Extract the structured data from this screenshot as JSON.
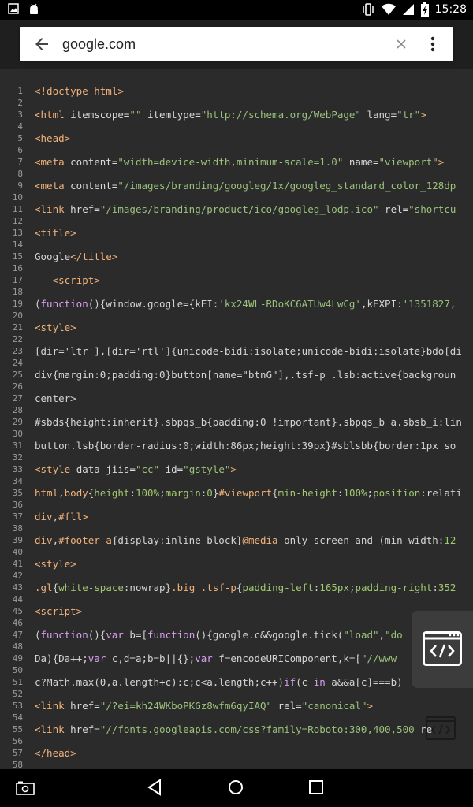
{
  "status_bar": {
    "time": "15:28",
    "icons_left": [
      "image-icon",
      "android-icon"
    ],
    "icons_right": [
      "vibrate-icon",
      "wifi-icon",
      "signal-icon",
      "battery-charging-icon"
    ]
  },
  "app_bar": {
    "url": "google.com",
    "back_icon": "arrow-back-icon",
    "clear_icon": "close-icon",
    "menu_icon": "more-vert-icon"
  },
  "code": {
    "line_numbers": [
      "1",
      "2",
      "3",
      "4",
      "5",
      "6",
      "7",
      "8",
      "9",
      "10",
      "11",
      "12",
      "13",
      "14",
      "15",
      "16",
      "17",
      "18",
      "19",
      "20",
      "21",
      "22",
      "23",
      "24",
      "25",
      "26",
      "27",
      "28",
      "29",
      "30",
      "31",
      "32",
      "33",
      "34",
      "35",
      "36",
      "37",
      "38",
      "39",
      "40",
      "41",
      "42",
      "43",
      "44",
      "45",
      "46",
      "47",
      "48",
      "49",
      "50",
      "51",
      "52",
      "53",
      "54",
      "55",
      "56",
      "57",
      "58"
    ],
    "lines": [
      {
        "n": 1,
        "segs": [
          [
            "tag",
            "<!doctype html>"
          ]
        ]
      },
      {
        "n": 3,
        "segs": [
          [
            "tag",
            "<html "
          ],
          [
            "attr",
            "itemscope="
          ],
          [
            "str",
            "\"\""
          ],
          [
            "attr",
            " itemtype="
          ],
          [
            "str",
            "\"http://schema.org/WebPage\""
          ],
          [
            "attr",
            " lang="
          ],
          [
            "str",
            "\"tr\""
          ],
          [
            "tag",
            ">"
          ]
        ]
      },
      {
        "n": 5,
        "segs": [
          [
            "tag",
            "<head>"
          ]
        ]
      },
      {
        "n": 7,
        "segs": [
          [
            "tag",
            "<meta "
          ],
          [
            "attr",
            "content="
          ],
          [
            "str",
            "\"width=device-width,minimum-scale=1.0\""
          ],
          [
            "attr",
            " name="
          ],
          [
            "str",
            "\"viewport\""
          ],
          [
            "tag",
            ">"
          ]
        ]
      },
      {
        "n": 9,
        "segs": [
          [
            "tag",
            "<meta "
          ],
          [
            "attr",
            "content="
          ],
          [
            "str",
            "\"/images/branding/googleg/1x/googleg_standard_color_128dp"
          ]
        ]
      },
      {
        "n": 11,
        "segs": [
          [
            "tag",
            "<link "
          ],
          [
            "attr",
            "href="
          ],
          [
            "str",
            "\"/images/branding/product/ico/googleg_lodp.ico\""
          ],
          [
            "attr",
            " rel="
          ],
          [
            "str",
            "\"shortcu"
          ]
        ]
      },
      {
        "n": 13,
        "segs": [
          [
            "tag",
            "<title>"
          ]
        ]
      },
      {
        "n": 15,
        "segs": [
          [
            "txt",
            "Google"
          ],
          [
            "tag",
            "</title>"
          ]
        ]
      },
      {
        "n": 17,
        "segs": [
          [
            "txt",
            "   "
          ],
          [
            "tag",
            "<script>"
          ]
        ]
      },
      {
        "n": 19,
        "segs": [
          [
            "txt",
            "("
          ],
          [
            "kw",
            "function"
          ],
          [
            "txt",
            "(){window.google={kEI:"
          ],
          [
            "str",
            "'kx24WL-RDoKC6ATUw4LwCg'"
          ],
          [
            "txt",
            ",kEXPI:"
          ],
          [
            "str",
            "'1351827,"
          ]
        ]
      },
      {
        "n": 21,
        "segs": [
          [
            "tag",
            "<style>"
          ]
        ]
      },
      {
        "n": 23,
        "segs": [
          [
            "txt",
            "[dir='ltr'],[dir='rtl']{unicode-bidi:isolate;unicode-bidi:isolate}bdo[di"
          ]
        ]
      },
      {
        "n": 25,
        "segs": [
          [
            "txt",
            "div{margin:0;padding:0}button[name=\"btnG\"],.tsf-p .lsb:active{backgroun"
          ]
        ]
      },
      {
        "n": 27,
        "segs": [
          [
            "txt",
            "center>"
          ]
        ]
      },
      {
        "n": 29,
        "segs": [
          [
            "txt",
            "#sbds{height:inherit}.sbpqs_b{padding:0 !important}.sbpqs_b a.sbsb_i:lin"
          ]
        ]
      },
      {
        "n": 31,
        "segs": [
          [
            "txt",
            "button.lsb{border-radius:0;width:86px;height:39px}#sblsbb{border:1px so"
          ]
        ]
      },
      {
        "n": 33,
        "segs": [
          [
            "tag",
            "<style "
          ],
          [
            "attr",
            "data-jiis="
          ],
          [
            "str",
            "\"cc\""
          ],
          [
            "attr",
            " id="
          ],
          [
            "str",
            "\"gstyle\""
          ],
          [
            "tag",
            ">"
          ]
        ]
      },
      {
        "n": 35,
        "segs": [
          [
            "tag",
            "html"
          ],
          [
            "txt",
            ","
          ],
          [
            "tag",
            "body"
          ],
          [
            "txt",
            "{"
          ],
          [
            "prop",
            "height"
          ],
          [
            "txt",
            ":"
          ],
          [
            "prop",
            "100%"
          ],
          [
            "txt",
            ";"
          ],
          [
            "prop",
            "margin"
          ],
          [
            "txt",
            ":"
          ],
          [
            "prop",
            "0"
          ],
          [
            "txt",
            "}"
          ],
          [
            "tag",
            "#viewport"
          ],
          [
            "txt",
            "{"
          ],
          [
            "prop",
            "min-height"
          ],
          [
            "txt",
            ":"
          ],
          [
            "prop",
            "100%"
          ],
          [
            "txt",
            ";"
          ],
          [
            "prop",
            "position"
          ],
          [
            "txt",
            ":relati"
          ]
        ]
      },
      {
        "n": 37,
        "segs": [
          [
            "tag",
            "div"
          ],
          [
            "txt",
            ","
          ],
          [
            "tag",
            "#fll"
          ],
          [
            "tag",
            ">"
          ]
        ]
      },
      {
        "n": 39,
        "segs": [
          [
            "tag",
            "div"
          ],
          [
            "txt",
            ","
          ],
          [
            "tag",
            "#footer a"
          ],
          [
            "txt",
            "{display:inline-block}"
          ],
          [
            "tag",
            "@media"
          ],
          [
            "txt",
            " only screen and (min-width:"
          ],
          [
            "prop",
            "12"
          ]
        ]
      },
      {
        "n": 41,
        "segs": [
          [
            "tag",
            "<style>"
          ]
        ]
      },
      {
        "n": 43,
        "segs": [
          [
            "tag",
            ".gl"
          ],
          [
            "txt",
            "{"
          ],
          [
            "prop",
            "white-space"
          ],
          [
            "txt",
            ":nowrap}"
          ],
          [
            "tag",
            ".big .tsf-p"
          ],
          [
            "txt",
            "{"
          ],
          [
            "prop",
            "padding-left"
          ],
          [
            "txt",
            ":"
          ],
          [
            "prop",
            "165px"
          ],
          [
            "txt",
            ";"
          ],
          [
            "prop",
            "padding-right"
          ],
          [
            "txt",
            ":"
          ],
          [
            "prop",
            "352"
          ]
        ]
      },
      {
        "n": 45,
        "segs": [
          [
            "tag",
            "<script>"
          ]
        ]
      },
      {
        "n": 47,
        "segs": [
          [
            "txt",
            "("
          ],
          [
            "kw",
            "function"
          ],
          [
            "txt",
            "(){"
          ],
          [
            "kw",
            "var"
          ],
          [
            "txt",
            " b=["
          ],
          [
            "kw",
            "function"
          ],
          [
            "txt",
            "(){google.c&&google.tick("
          ],
          [
            "str",
            "\"load\""
          ],
          [
            "txt",
            ","
          ],
          [
            "str",
            "\"do"
          ]
        ]
      },
      {
        "n": 49,
        "segs": [
          [
            "txt",
            "Da){Da++;"
          ],
          [
            "kw",
            "var"
          ],
          [
            "txt",
            " c,d=a;b=b||{};"
          ],
          [
            "kw",
            "var"
          ],
          [
            "txt",
            " f=encodeURIComponent,k=["
          ],
          [
            "str",
            "\"//www"
          ]
        ]
      },
      {
        "n": 51,
        "segs": [
          [
            "txt",
            "c?Math.max(0,a.length+c):c;c<a.length;c++)"
          ],
          [
            "kw",
            "if"
          ],
          [
            "txt",
            "(c "
          ],
          [
            "kw",
            "in"
          ],
          [
            "txt",
            " a&&a[c]===b)"
          ]
        ]
      },
      {
        "n": 53,
        "segs": [
          [
            "tag",
            "<link "
          ],
          [
            "attr",
            "href="
          ],
          [
            "str",
            "\"/?ei=kh24WKboPKGz8wfm6qyIAQ\""
          ],
          [
            "attr",
            " rel="
          ],
          [
            "str",
            "\"canonical\""
          ],
          [
            "tag",
            ">"
          ]
        ]
      },
      {
        "n": 55,
        "segs": [
          [
            "tag",
            "<link "
          ],
          [
            "attr",
            "href="
          ],
          [
            "str",
            "\"//fonts.googleapis.com/css?family=Roboto:300,400,500"
          ],
          [
            "attr",
            " re"
          ]
        ]
      },
      {
        "n": 57,
        "segs": [
          [
            "tag",
            "</head>"
          ]
        ]
      }
    ]
  },
  "fab": {
    "icon": "code-view-icon"
  },
  "nav_bar": {
    "icons": [
      "screenshot-icon",
      "back-triangle-icon",
      "home-circle-icon",
      "recents-square-icon"
    ]
  }
}
